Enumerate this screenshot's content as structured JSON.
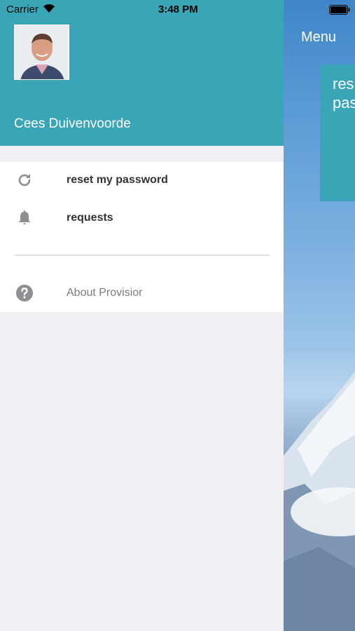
{
  "status_bar": {
    "carrier": "Carrier",
    "time": "3:48 PM"
  },
  "drawer": {
    "user_name": "Cees Duivenvoorde",
    "menu_items": [
      {
        "label": "reset my password",
        "icon": "refresh-icon"
      },
      {
        "label": "requests",
        "icon": "bell-icon"
      }
    ],
    "about": {
      "label": "About Provisior",
      "icon": "question-circle-icon"
    }
  },
  "background": {
    "menu_label": "Menu",
    "tile_text_line1": "res",
    "tile_text_line2": "pas"
  },
  "colors": {
    "accent": "#3aa5b6",
    "drawer_bg": "#efeff4",
    "icon_gray": "#8e8e93"
  }
}
